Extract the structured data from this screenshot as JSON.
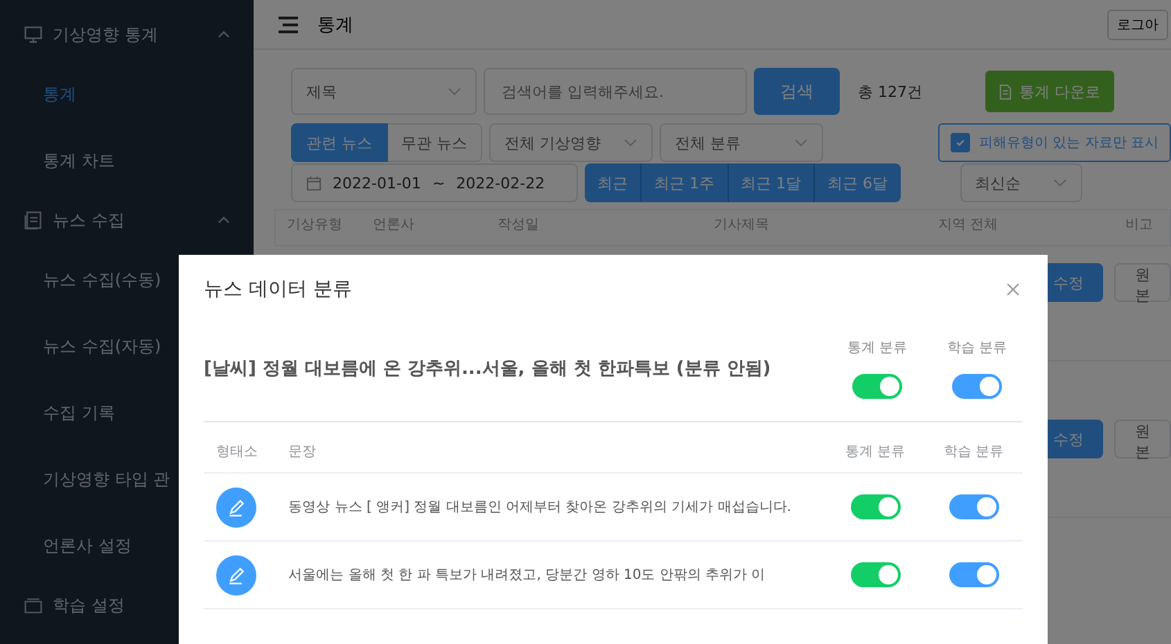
{
  "sidebar": {
    "sections": [
      {
        "label": "기상영향 통계",
        "expanded": true,
        "items": [
          {
            "label": "통계",
            "selected": true
          },
          {
            "label": "통계 차트",
            "selected": false
          }
        ]
      },
      {
        "label": "뉴스 수집",
        "expanded": true,
        "items": [
          {
            "label": "뉴스 수집(수동)",
            "selected": false
          },
          {
            "label": "뉴스 수집(자동)",
            "selected": false
          },
          {
            "label": "수집 기록",
            "selected": false
          },
          {
            "label": "기상영향 타입 관",
            "selected": false
          },
          {
            "label": "언론사 설정",
            "selected": false
          }
        ]
      },
      {
        "label": "학습 설정"
      }
    ]
  },
  "header": {
    "title": "통계",
    "logout": "로그아"
  },
  "search": {
    "field_select": "제목",
    "placeholder": "검색어를 입력해주세요.",
    "button": "검색",
    "total": "총 127건",
    "download": "통계 다운로"
  },
  "news_tabs": [
    {
      "label": "관련 뉴스",
      "selected": true
    },
    {
      "label": "무관 뉴스",
      "selected": false
    }
  ],
  "filters": [
    "전체 기상영향",
    "전체 분류"
  ],
  "damage_only": {
    "label": "피해유형이 있는 자료만 표시",
    "checked": true
  },
  "date_range": {
    "start": "2022-01-01",
    "separator": "~",
    "end": "2022-02-22"
  },
  "period_buttons": [
    "최근",
    "최근 1주",
    "최근 1달",
    "최근 6달"
  ],
  "sort": "최신순",
  "table": {
    "columns": [
      "기상유형",
      "언론사",
      "작성일",
      "기사제목",
      "지역 전체",
      "비고"
    ],
    "rows": [
      {
        "edit": "수정",
        "original": "원본"
      },
      {
        "edit": "수정",
        "original": "원본"
      }
    ]
  },
  "modal": {
    "title": "뉴스 데이터 분류",
    "article_title": "[날씨] 정월 대보름에 온 강추위...서울, 올해 첫 한파특보 (분류 안됨)",
    "toggle_labels": [
      "통계 분류",
      "학습 분류"
    ],
    "article_toggles": [
      {
        "on": true
      },
      {
        "on": true
      }
    ],
    "columns": [
      "형태소",
      "문장",
      "통계 분류",
      "학습 분류"
    ],
    "sentences": [
      {
        "text": "동영상 뉴스 [ 앵커] 정월 대보름인 어제부터 찾아온 강추위의 기세가 매섭습니다.",
        "toggles": [
          {
            "on": true
          },
          {
            "on": true
          }
        ]
      },
      {
        "text": "서울에는 올해 첫 한 파 특보가 내려졌고, 당분간 영하 10도 안팎의 추위가 이",
        "toggles": [
          {
            "on": true
          },
          {
            "on": true
          }
        ]
      }
    ]
  }
}
